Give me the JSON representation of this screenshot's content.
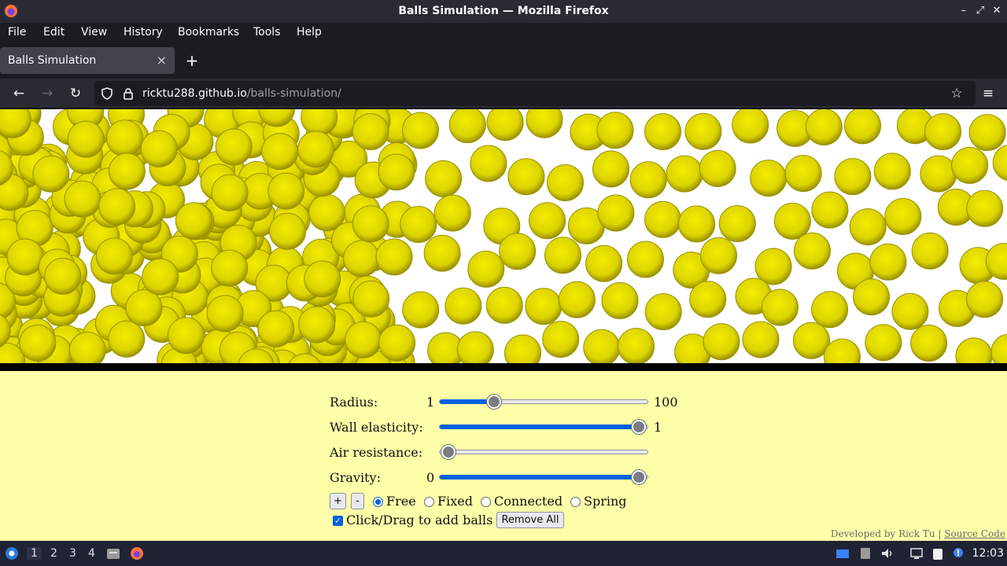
{
  "window": {
    "title": "Balls Simulation — Mozilla Firefox"
  },
  "menubar": [
    "File",
    "Edit",
    "View",
    "History",
    "Bookmarks",
    "Tools",
    "Help"
  ],
  "tab": {
    "label": "Balls Simulation",
    "close": "×",
    "new_tab": "+"
  },
  "navbar": {
    "url_host": "ricktu288.github.io",
    "url_path": "/balls-simulation/"
  },
  "controls": {
    "radius": {
      "label": "Radius:",
      "min": "1",
      "max": "100",
      "value": 25
    },
    "wall_elasticity": {
      "label": "Wall elasticity:",
      "min": "0",
      "max": "1",
      "value": 1
    },
    "air_resistance": {
      "label": "Air resistance:",
      "min": "0",
      "max": "",
      "value": 0
    },
    "gravity": {
      "label": "Gravity:",
      "min": "0",
      "max": "",
      "value": 1
    },
    "add_button": "+",
    "remove_button": "-",
    "modes": [
      {
        "label": "Free",
        "checked": true
      },
      {
        "label": "Fixed",
        "checked": false
      },
      {
        "label": "Connected",
        "checked": false
      },
      {
        "label": "Spring",
        "checked": false
      }
    ],
    "click_drag_label": "Click/Drag to add balls",
    "click_drag_checked": true,
    "remove_all": "Remove All"
  },
  "footer": {
    "developed_by": "Developed by Rick Tu",
    "separator": "|",
    "source_code": "Source Code"
  },
  "taskbar": {
    "workspaces": [
      "1",
      "2",
      "3",
      "4"
    ],
    "active_workspace": "1",
    "clock": "12:03"
  },
  "colors": {
    "ball": "#e8e000",
    "ball_edge": "#9a9200",
    "page_bg": "#ffffaa",
    "accent": "#0060df"
  }
}
